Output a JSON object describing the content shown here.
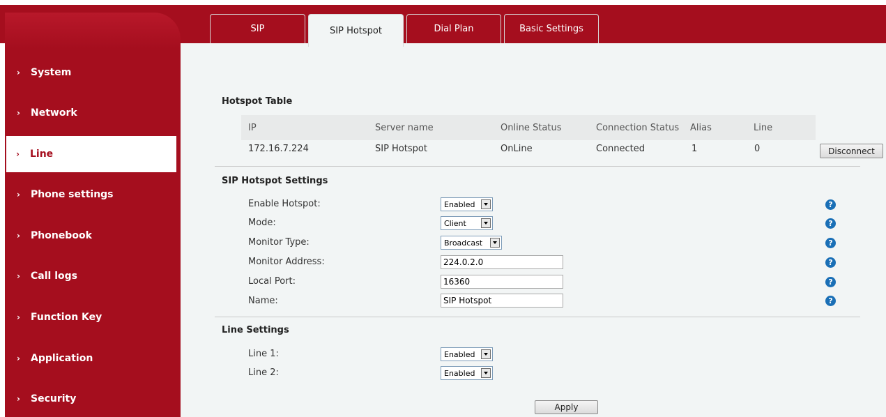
{
  "sidebar": {
    "items": [
      {
        "label": "System"
      },
      {
        "label": "Network"
      },
      {
        "label": "Line"
      },
      {
        "label": "Phone settings"
      },
      {
        "label": "Phonebook"
      },
      {
        "label": "Call logs"
      },
      {
        "label": "Function Key"
      },
      {
        "label": "Application"
      },
      {
        "label": "Security"
      }
    ],
    "chevron": "›"
  },
  "tabs": [
    {
      "label": "SIP"
    },
    {
      "label": "SIP Hotspot"
    },
    {
      "label": "Dial Plan"
    },
    {
      "label": "Basic Settings"
    }
  ],
  "hotspot_table": {
    "title": "Hotspot Table",
    "headers": [
      "IP",
      "Server name",
      "Online Status",
      "Connection Status",
      "Alias",
      "Line"
    ],
    "row": [
      "172.16.7.224",
      "SIP Hotspot",
      "OnLine",
      "Connected",
      "1",
      "0"
    ],
    "disconnect_label": "Disconnect"
  },
  "hotspot_settings": {
    "title": "SIP Hotspot Settings",
    "enable_label": "Enable Hotspot:",
    "enable_value": "Enabled",
    "mode_label": "Mode:",
    "mode_value": "Client",
    "monitor_type_label": "Monitor Type:",
    "monitor_type_value": "Broadcast",
    "monitor_address_label": "Monitor Address:",
    "monitor_address_value": "224.0.2.0",
    "local_port_label": "Local Port:",
    "local_port_value": "16360",
    "name_label": "Name:",
    "name_value": "SIP Hotspot"
  },
  "line_settings": {
    "title": "Line Settings",
    "line1_label": "Line 1:",
    "line1_value": "Enabled",
    "line2_label": "Line 2:",
    "line2_value": "Enabled"
  },
  "apply_label": "Apply",
  "help_glyph": "?",
  "colors": {
    "brand_red": "#a50e1e",
    "help_blue": "#1a6fb6"
  }
}
